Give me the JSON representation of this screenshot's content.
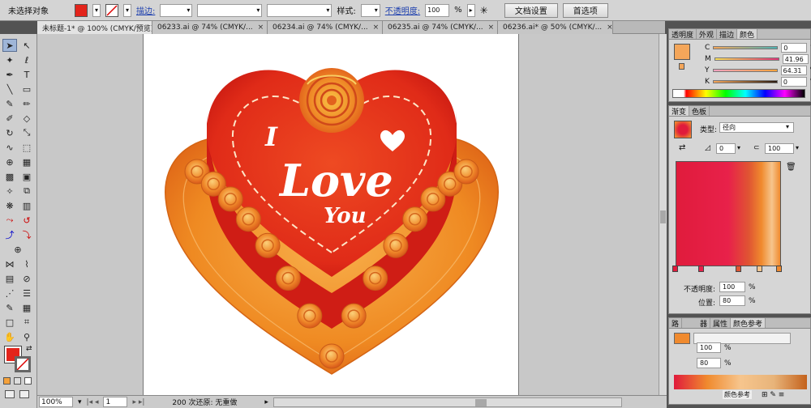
{
  "control_bar": {
    "selection_label": "未选择对象",
    "stroke_label": "描边:",
    "style_label": "样式:",
    "opacity_label": "不透明度:",
    "opacity_value": "100",
    "percent": "%",
    "doc_setup_button": "文档设置",
    "preferences_button": "首选项"
  },
  "document_tabs": [
    {
      "label": "未标题-1* @ 100% (CMYK/预览)",
      "close": "×"
    },
    {
      "label": "06233.ai @ 74% (CMYK/...",
      "close": "×"
    },
    {
      "label": "06234.ai @ 74% (CMYK/...",
      "close": "×"
    },
    {
      "label": "06235.ai @ 74% (CMYK/...",
      "close": "×"
    },
    {
      "label": "06236.ai* @ 50% (CMYK/...",
      "close": "×"
    }
  ],
  "artwork": {
    "line1": "I",
    "line2": "Love",
    "line3": "You"
  },
  "status_bar": {
    "zoom": "100%",
    "page": "1",
    "undo_status": "200 次还原: 无重做"
  },
  "color_panel": {
    "tabs": [
      "透明度",
      "外观",
      "描边",
      "颜色"
    ],
    "active_tab": "颜色",
    "channels": [
      {
        "label": "C",
        "value": "0"
      },
      {
        "label": "M",
        "value": "41.96"
      },
      {
        "label": "Y",
        "value": "64.31"
      },
      {
        "label": "K",
        "value": "0"
      }
    ],
    "percent": "%",
    "fill_color": "#f4a65a"
  },
  "gradient_panel": {
    "tabs": [
      "渐变",
      "色板"
    ],
    "active_tab": "渐变",
    "type_label": "类型:",
    "type_value": "径向",
    "angle_value": "0",
    "aspect_value": "100",
    "opacity_label": "不透明度:",
    "opacity_value": "100",
    "location_label": "位置:",
    "location_value": "80",
    "percent": "%",
    "colors": {
      "red": "#e01b3c",
      "orange": "#f08a2e",
      "light": "#f6c58d"
    }
  },
  "bottom_panel": {
    "tabs": [
      "路",
      "器",
      "属性",
      "颜色参考"
    ],
    "value1": "100",
    "value2": "80",
    "percent": "%",
    "footer_label": "颜色参考"
  }
}
